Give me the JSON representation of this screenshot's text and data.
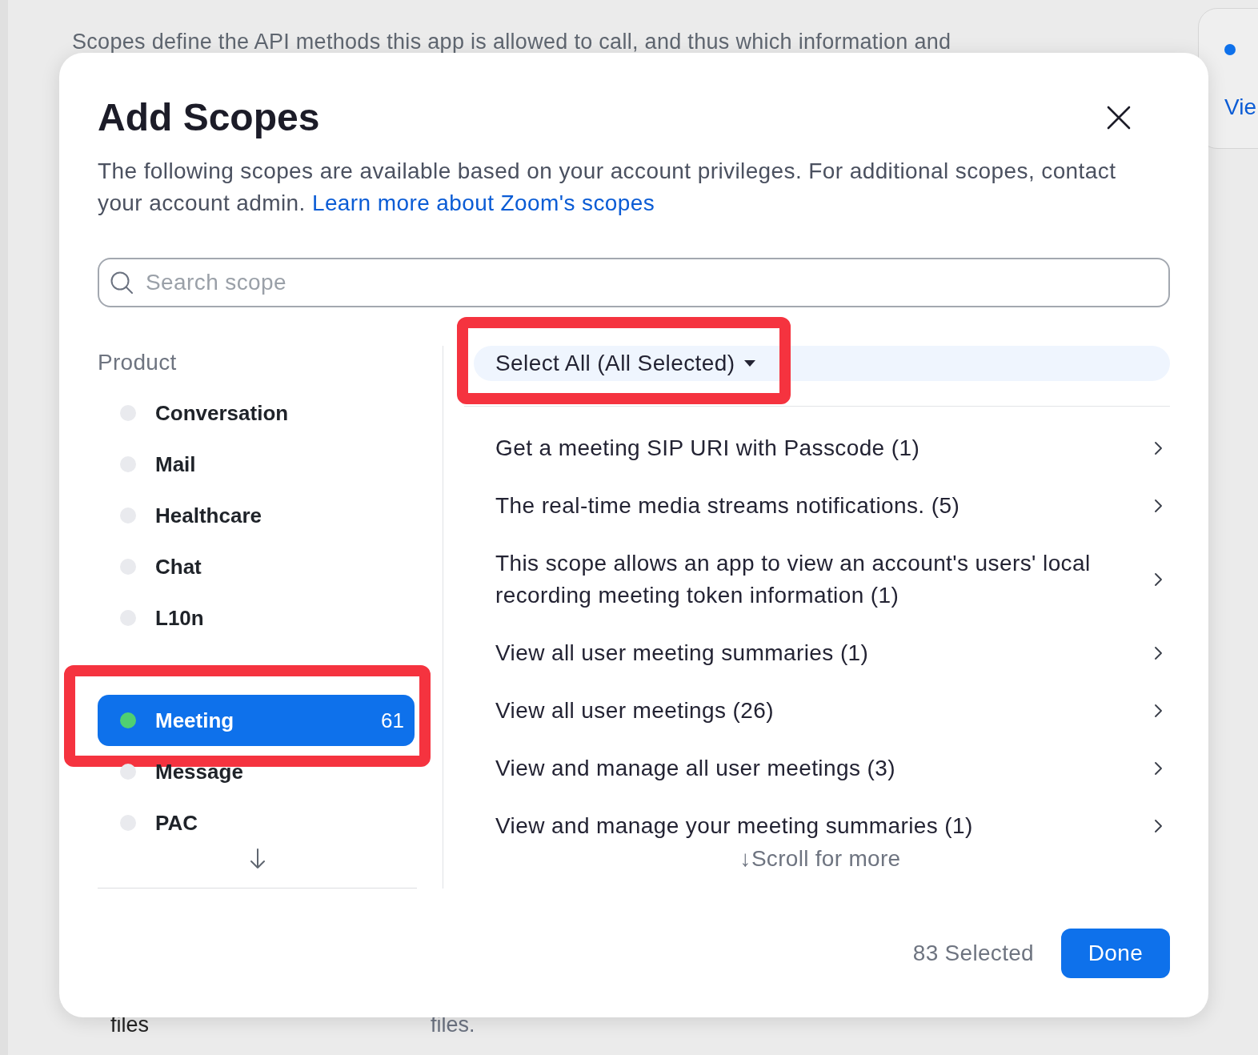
{
  "background": {
    "description": "Scopes define the API methods this app is allowed to call, and thus which information and",
    "side_card": {
      "link": "Vie"
    },
    "bottom_texts": [
      "files",
      "files."
    ]
  },
  "dialog": {
    "title": "Add Scopes",
    "description": "The following scopes are available based on your account privileges. For additional scopes, contact your account admin.",
    "link": "Learn more about Zoom's scopes",
    "search": {
      "placeholder": "Search scope"
    },
    "product_heading": "Product",
    "products": [
      {
        "kind": "product",
        "label": "Conversation",
        "selected": false,
        "highlighted": false
      },
      {
        "kind": "product",
        "label": "Mail",
        "selected": false,
        "highlighted": false
      },
      {
        "kind": "product",
        "label": "Healthcare",
        "selected": false,
        "highlighted": false
      },
      {
        "kind": "product",
        "label": "Chat",
        "selected": false,
        "highlighted": false
      },
      {
        "kind": "product",
        "label": "L10n",
        "selected": false,
        "highlighted": false
      },
      {
        "kind": "covered"
      },
      {
        "kind": "product",
        "label": "Meeting",
        "count": "61",
        "selected": true,
        "highlighted": true
      },
      {
        "kind": "product",
        "label": "Message",
        "selected": false,
        "highlighted": false
      },
      {
        "kind": "product",
        "label": "PAC",
        "selected": false,
        "highlighted": false
      }
    ],
    "select_all": {
      "label": "Select All (All Selected)",
      "highlighted": true
    },
    "scopes": [
      {
        "label": "Get a meeting SIP URI with Passcode (1)"
      },
      {
        "label": "The real-time media streams notifications. (5)"
      },
      {
        "label": "This scope allows an app to view an account's users' local recording meeting token information (1)"
      },
      {
        "label": "View all user meeting summaries (1)"
      },
      {
        "label": "View all user meetings (26)"
      },
      {
        "label": "View and manage all user meetings (3)"
      },
      {
        "label": "View and manage your meeting summaries (1)"
      }
    ],
    "scroll_hint": "↓Scroll for more",
    "selected_count": "83 Selected",
    "done_button": "Done"
  }
}
